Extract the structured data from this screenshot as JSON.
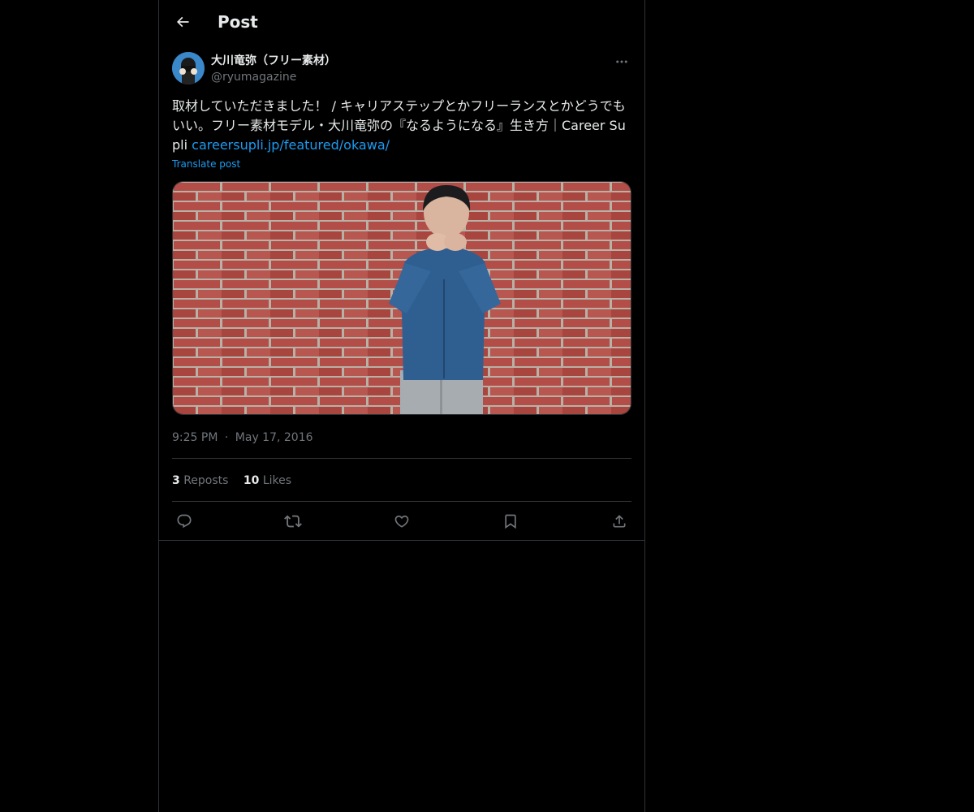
{
  "header": {
    "title": "Post"
  },
  "post": {
    "author": {
      "display_name": "大川竜弥（フリー素材）",
      "handle": "@ryumagazine"
    },
    "text": "取材していただきました！ / キャリアステップとかフリーランスとかどうでもいい。フリー素材モデル・大川竜弥の『なるようになる』生き方｜Career Supli ",
    "link_text": "careersupli.jp/featured/okawa/",
    "translate_label": "Translate post",
    "time": "9:25 PM",
    "separator": "·",
    "date": "May 17, 2016",
    "stats": {
      "reposts_count": "3",
      "reposts_label": "Reposts",
      "likes_count": "10",
      "likes_label": "Likes"
    }
  },
  "icons": {
    "back": "arrow-left-icon",
    "more": "more-horizontal-icon",
    "reply": "reply-icon",
    "repost": "repost-icon",
    "like": "heart-icon",
    "bookmark": "bookmark-icon",
    "share": "share-icon"
  },
  "colors": {
    "background": "#000000",
    "border": "#2f3336",
    "text": "#e7e9ea",
    "muted": "#71767b",
    "accent": "#1d9bf0"
  }
}
